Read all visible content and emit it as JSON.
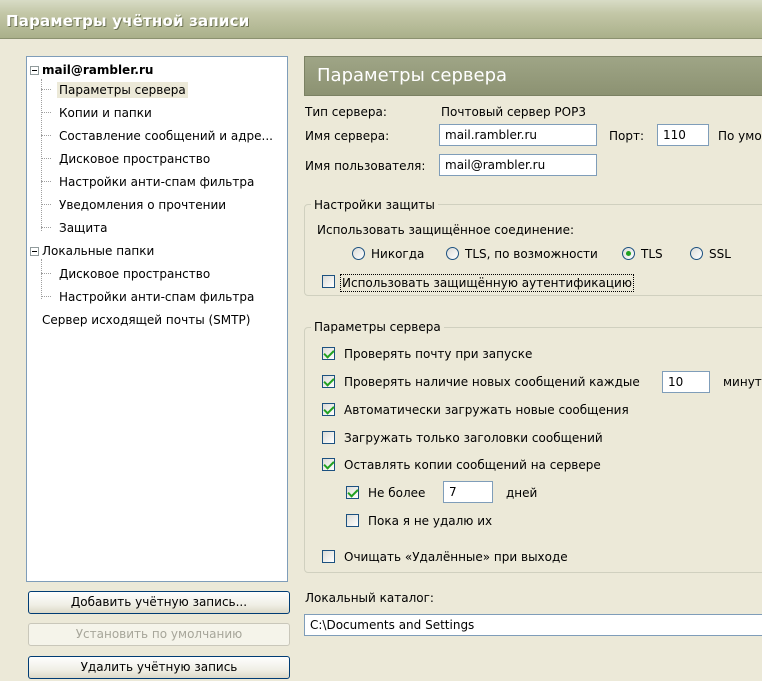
{
  "window": {
    "title": "Параметры учётной записи"
  },
  "tree": {
    "account": "mail@rambler.ru",
    "account_items": [
      "Параметры сервера",
      "Копии и папки",
      "Составление сообщений и адре...",
      "Дисковое пространство",
      "Настройки анти-спам фильтра",
      "Уведомления о прочтении",
      "Защита"
    ],
    "local": "Локальные папки",
    "local_items": [
      "Дисковое пространство",
      "Настройки анти-спам фильтра"
    ],
    "smtp": "Сервер исходящей почты (SMTP)"
  },
  "buttons": {
    "add": "Добавить учётную запись...",
    "default": "Установить по умолчанию",
    "delete": "Удалить учётную запись"
  },
  "panel": {
    "header": "Параметры сервера",
    "server_type_label": "Тип сервера:",
    "server_type_value": "Почтовый сервер POP3",
    "server_name_label": "Имя сервера:",
    "server_name_value": "mail.rambler.ru",
    "port_label": "Порт:",
    "port_value": "110",
    "default_label": "По умо",
    "username_label": "Имя пользователя:",
    "username_value": "mail@rambler.ru"
  },
  "security": {
    "title": "Настройки защиты",
    "secure_conn_label": "Использовать защищённое соединение:",
    "radios": [
      "Никогда",
      "TLS, по возможности",
      "TLS",
      "SSL"
    ],
    "selected": "TLS",
    "auth_label": "Использовать защищённую аутентификацию"
  },
  "server_settings": {
    "title": "Параметры сервера",
    "check_on_start": "Проверять почту при запуске",
    "check_every": "Проверять наличие новых сообщений каждые",
    "check_every_value": "10",
    "minutes": "минут",
    "auto_download": "Автоматически загружать новые сообщения",
    "headers_only": "Загружать только заголовки сообщений",
    "leave_copies": "Оставлять копии сообщений на сервере",
    "no_more_than": "Не более",
    "days_value": "7",
    "days": "дней",
    "until_delete": "Пока я не удалю их",
    "empty_trash": "Очищать «Удалённые» при выходе"
  },
  "local_dir": {
    "label": "Локальный каталог:",
    "value": "C:\\Documents and Settings"
  }
}
